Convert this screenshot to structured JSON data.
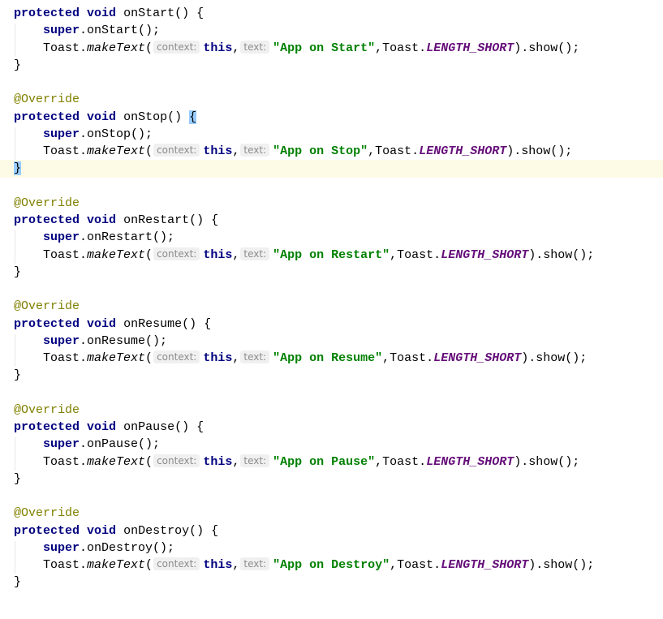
{
  "editor": {
    "methods": [
      {
        "annotation": "",
        "name": "onStart",
        "message": "\"App on Start\"",
        "current": false,
        "brace_highlight": false
      },
      {
        "annotation": "@Override",
        "name": "onStop",
        "message": "\"App on Stop\"",
        "current": true,
        "brace_highlight": true
      },
      {
        "annotation": "@Override",
        "name": "onRestart",
        "message": "\"App on Restart\"",
        "current": false,
        "brace_highlight": false
      },
      {
        "annotation": "@Override",
        "name": "onResume",
        "message": "\"App on Resume\"",
        "current": false,
        "brace_highlight": false
      },
      {
        "annotation": "@Override",
        "name": "onPause",
        "message": "\"App on Pause\"",
        "current": false,
        "brace_highlight": false
      },
      {
        "annotation": "@Override",
        "name": "onDestroy",
        "message": "\"App on Destroy\"",
        "current": false,
        "brace_highlight": false
      }
    ],
    "tokens": {
      "protected": "protected",
      "void": "void",
      "super": "super",
      "toast_class": "Toast",
      "make_text": "makeText",
      "hint_context": "context:",
      "this": "this",
      "hint_text": "text:",
      "length_short": "LENGTH_SHORT",
      "show": "show"
    },
    "colors": {
      "keyword": "#000080",
      "annotation": "#808000",
      "string": "#008000",
      "static_field": "#660e7a",
      "current_line": "#fdfae6",
      "brace_match": "#99ccff"
    }
  }
}
